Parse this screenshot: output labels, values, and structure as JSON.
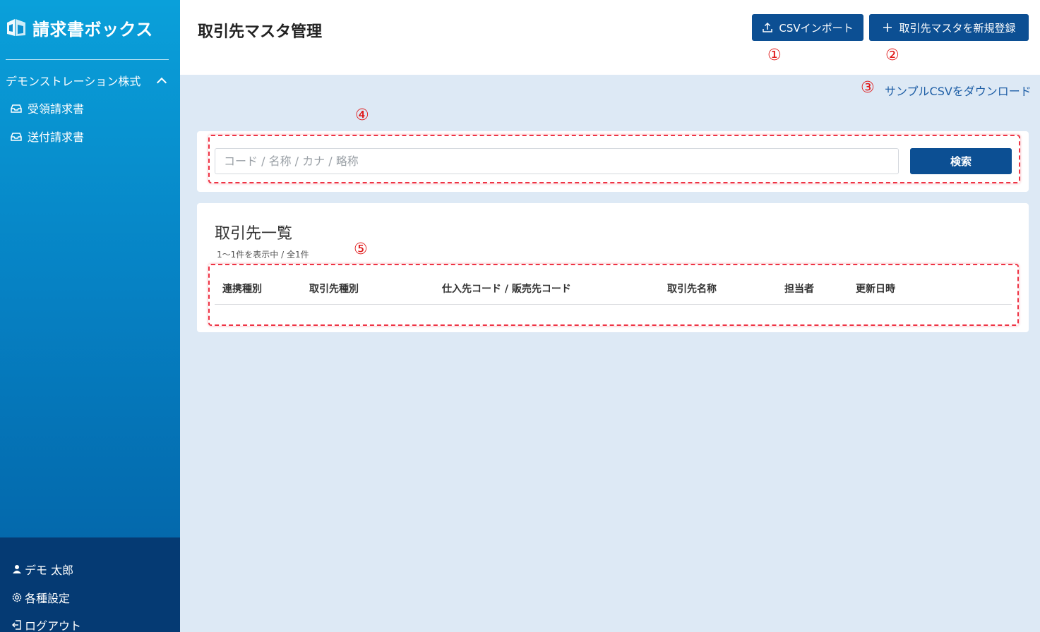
{
  "app": {
    "name": "請求書ボックス"
  },
  "sidebar": {
    "company": "デモンストレーション株式",
    "items": [
      {
        "label": "受領請求書",
        "icon": "inbox-icon"
      },
      {
        "label": "送付請求書",
        "icon": "outbox-icon"
      }
    ],
    "bottom": [
      {
        "label": "デモ 太郎",
        "icon": "user-icon"
      },
      {
        "label": "各種設定",
        "icon": "gear-icon"
      },
      {
        "label": "ログアウト",
        "icon": "logout-icon"
      }
    ]
  },
  "header": {
    "title": "取引先マスタ管理",
    "import_label": "CSVインポート",
    "new_label": "取引先マスタを新規登録",
    "sample_link": "サンプルCSVをダウンロード"
  },
  "annotations": [
    "①",
    "②",
    "③",
    "④",
    "⑤"
  ],
  "search": {
    "placeholder": "コード / 名称 / カナ / 略称",
    "value": "",
    "button": "検索"
  },
  "list": {
    "title": "取引先一覧",
    "count": "1〜1件を表示中 / 全1件",
    "columns": [
      "連携種別",
      "取引先種別",
      "仕入先コード / 販売先コード",
      "取引先名称",
      "担当者",
      "更新日時"
    ],
    "rows": []
  },
  "colors": {
    "primary": "#0c4f93",
    "sidebar_top": "#0aa0da",
    "sidebar_bottom": "#053a73",
    "background": "#dde9f5",
    "annotation": "#e01818"
  }
}
